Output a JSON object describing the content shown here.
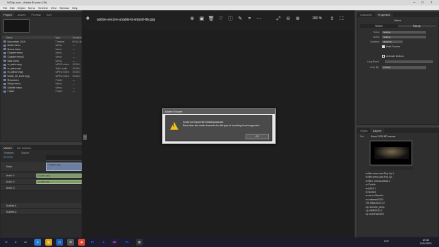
{
  "encore": {
    "title": "DVDtp.ncor - Adobe Encore CS6",
    "menus": [
      "File",
      "Edit",
      "Object",
      "Menu",
      "Timeline",
      "View",
      "Window",
      "Help"
    ],
    "workspace": "Workspace",
    "project_tabs": [
      "Project",
      "Assets",
      "Preview",
      "Sort"
    ],
    "project_columns": [
      "Name",
      "Type",
      "Duration"
    ],
    "project_items": [
      {
        "name": "Mon mtyfm 2019",
        "type": "Timeline",
        "duration": "00:04:16"
      },
      {
        "name": "Audio menu",
        "type": "Menu",
        "duration": "—"
      },
      {
        "name": "Bonus menu",
        "type": "Menu",
        "duration": "—"
      },
      {
        "name": "Chapter menu",
        "type": "Menu",
        "duration": "—"
      },
      {
        "name": "Chapter menu2",
        "type": "Menu",
        "duration": "—"
      },
      {
        "name": "Main menu",
        "type": "Menu",
        "duration": "—"
      },
      {
        "name": "m..pafro.mpg",
        "type": "MPEG video",
        "duration": "00:09:1"
      },
      {
        "name": "m..pafro.wav",
        "type": "WAV audio",
        "duration": "00:09:1"
      },
      {
        "name": "m..pafro2.mpg",
        "type": "MPEG video",
        "duration": "00:09:1"
      },
      {
        "name": "Movie_02_DVD.mpg",
        "type": "MPEG video",
        "duration": "00:04:1"
      },
      {
        "name": "Resources",
        "type": "Folder",
        "duration": "—"
      },
      {
        "name": "Setup menu",
        "type": "Menu",
        "duration": "—"
      },
      {
        "name": "Subtitle menu",
        "type": "Menu",
        "duration": "—"
      },
      {
        "name": "Trailer",
        "type": "Folder",
        "duration": "—"
      }
    ],
    "timeline_tabs": [
      "Viewer",
      "Mo Sanson"
    ],
    "timeline_header": [
      "Timelines",
      "Source"
    ],
    "timecode": "00:00:00",
    "tracks": [
      "Video",
      "Audio 1:",
      "Audio 2:",
      "Audio 3:",
      "Subtitle 1:",
      "Subtitle 2:"
    ],
    "clips": [
      "m..pafro2.mpg",
      "m..pafro.mpg",
      "m..pafro.wav"
    ],
    "properties_tabs": [
      "Character",
      "Properties"
    ],
    "properties_header": "Menu",
    "properties_subtabs": [
      "Motion",
      "Pop-up"
    ],
    "properties": [
      {
        "key": "Video:",
        "value": "Nothing"
      },
      {
        "key": "Audio:",
        "value": "Nothing"
      },
      {
        "key": "Duration:",
        "value": "00:00:30"
      }
    ],
    "hold_forever": "Hold Forever",
    "animate_buttons": "Animate Buttons",
    "loop_point": "Loop Point:",
    "loop_by": "Loop By:",
    "loop_by_value": "Forever",
    "library_tabs": [
      "Styles",
      "Layers"
    ],
    "library_set": "Kourd 2020 BD menus",
    "library_set_label": "Set:",
    "library_items": [
      "m film menu and Pop Up 1",
      "m film menu and Pop Up",
      "m films menuColletta 2",
      "m Castile",
      "m MDO 1",
      "m Screen",
      "m menu Generic",
      "m universal2020",
      "TM MBM2020 2.2",
      "Up Generic_temp",
      "Up MBM2020 3",
      "up universal2020"
    ]
  },
  "viewer": {
    "file_title": "adobe-encore-unable-to-import-file.jpg",
    "zoom": "100 %",
    "icons": [
      "zoom-icon",
      "image-icon",
      "delete-icon",
      "heart-icon",
      "info-icon",
      "edit-icon",
      "crop-icon",
      "more-icon",
      "share-icon",
      "expand-icon",
      "fullscreen-icon"
    ]
  },
  "dialog": {
    "title": "Adobe Encore",
    "message_line1": "Could not import file:\\Desktop\\aaa.avi.",
    "message_line2": "More than two audio channels for this type of encoding is not supported.",
    "ok_label": "OK"
  },
  "taskbar": {
    "time": "19:46",
    "date": "01/11/2023",
    "lang": "ESP"
  }
}
